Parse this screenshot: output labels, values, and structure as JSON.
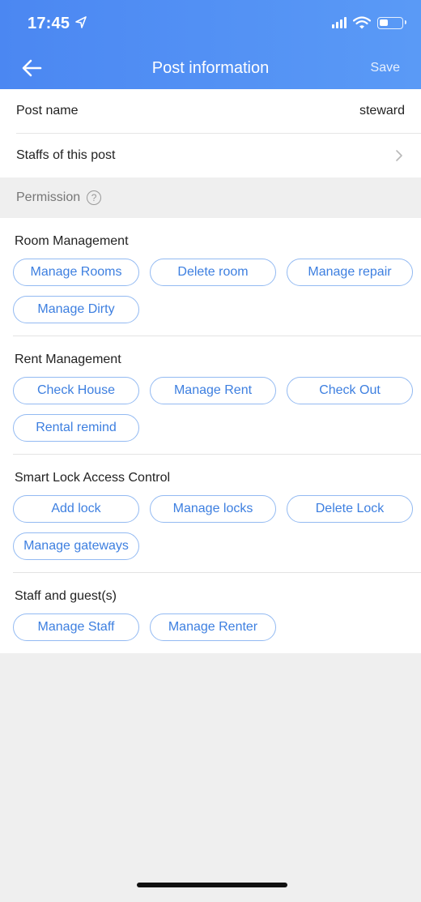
{
  "status_bar": {
    "time": "17:45"
  },
  "nav": {
    "title": "Post information",
    "save_label": "Save"
  },
  "rows": [
    {
      "label": "Post name",
      "value": "steward"
    },
    {
      "label": "Staffs of this post"
    }
  ],
  "permission": {
    "label": "Permission",
    "help": "?"
  },
  "sections": [
    {
      "title": "Room Management",
      "chips": [
        "Manage Rooms",
        "Delete room",
        "Manage repair",
        "Manage Dirty"
      ]
    },
    {
      "title": "Rent Management",
      "chips": [
        "Check House",
        "Manage Rent",
        "Check Out",
        "Rental remind"
      ]
    },
    {
      "title": "Smart Lock Access Control",
      "chips": [
        "Add lock",
        "Manage locks",
        "Delete Lock",
        "Manage gateways"
      ]
    },
    {
      "title": "Staff and guest(s)",
      "chips": [
        "Manage Staff",
        "Manage Renter"
      ]
    }
  ],
  "colors": {
    "header": "#4b87f2",
    "chip_text": "#3d7fe0",
    "chip_border": "#93baf2",
    "background": "#efefef"
  }
}
